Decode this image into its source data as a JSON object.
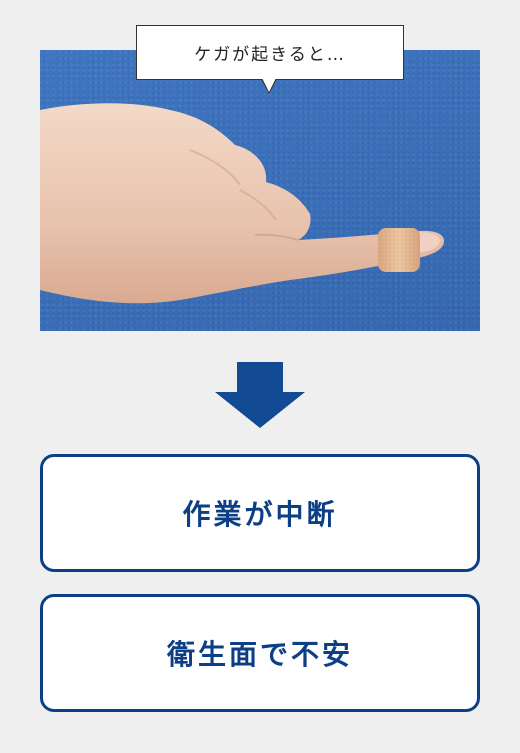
{
  "bubble": {
    "text": "ケガが起きると…"
  },
  "photo": {
    "subject": "hand-with-bandage",
    "background_color": "#3b70ba"
  },
  "arrow": {
    "icon": "down-arrow-icon",
    "color": "#124a93"
  },
  "results": [
    {
      "label": "作業が中断"
    },
    {
      "label": "衛生面で不安"
    }
  ],
  "colors": {
    "accent": "#0d3f86",
    "page_background": "#efefef"
  }
}
